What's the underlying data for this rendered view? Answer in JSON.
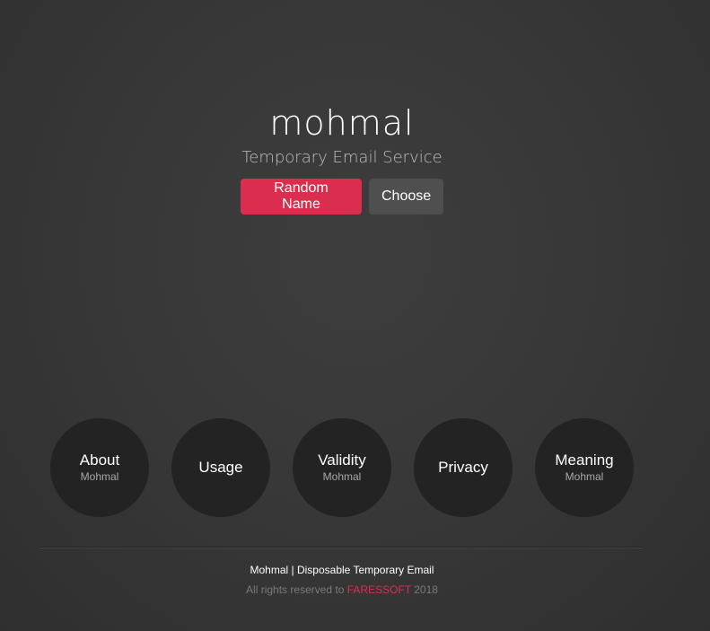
{
  "header": {
    "logo_text": "mohmal",
    "logo_prefix": "m",
    "logo_o": "o",
    "logo_suffix": "hmal",
    "tagline": "Temporary Email Service"
  },
  "actions": {
    "random_name_label": "Random Name",
    "choose_label": "Choose"
  },
  "info_circles": [
    {
      "title": "About",
      "subtitle": "Mohmal"
    },
    {
      "title": "Usage",
      "subtitle": ""
    },
    {
      "title": "Validity",
      "subtitle": "Mohmal"
    },
    {
      "title": "Privacy",
      "subtitle": ""
    },
    {
      "title": "Meaning",
      "subtitle": "Mohmal"
    }
  ],
  "footer": {
    "line1": "Mohmal | Disposable Temporary Email",
    "rights_prefix": "All rights reserved to ",
    "brand": "FARESSOFT",
    "year": " 2018"
  },
  "colors": {
    "background": "#383838",
    "accent": "#db2e4e",
    "circle": "#232323",
    "secondary_button": "#4f4f4f"
  }
}
